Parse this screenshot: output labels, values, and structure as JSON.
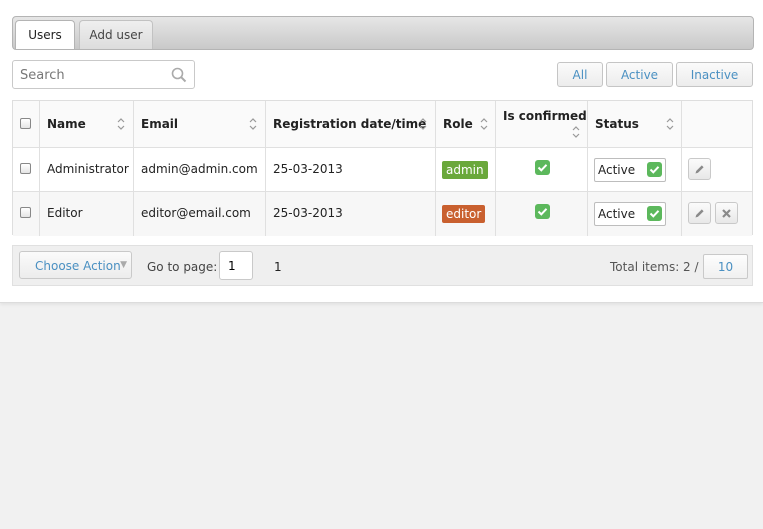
{
  "tabs": [
    {
      "label": "Users",
      "active": true
    },
    {
      "label": "Add user",
      "active": false
    }
  ],
  "search": {
    "placeholder": "Search",
    "value": ""
  },
  "filters": [
    "All",
    "Active",
    "Inactive"
  ],
  "table": {
    "columns": [
      "Name",
      "Email",
      "Registration date/time",
      "Role",
      "Is confirmed",
      "Status"
    ],
    "rows": [
      {
        "name": "Administrator",
        "email": "admin@admin.com",
        "registered": "25-03-2013",
        "role": "admin",
        "role_color": "#6aa83b",
        "confirmed": true,
        "status": "Active",
        "actions": [
          "edit"
        ]
      },
      {
        "name": "Editor",
        "email": "editor@email.com",
        "registered": "25-03-2013",
        "role": "editor",
        "role_color": "#c9602f",
        "confirmed": true,
        "status": "Active",
        "actions": [
          "edit",
          "delete"
        ]
      }
    ]
  },
  "footer": {
    "choose_action": "Choose Action",
    "goto_label": "Go to page:",
    "current_page": "1",
    "page_count": "1",
    "total_label": "Total items: 2 /",
    "per_page": "10"
  },
  "colors": {
    "accent_link": "#4a90c2",
    "check_green": "#5cb85c"
  }
}
